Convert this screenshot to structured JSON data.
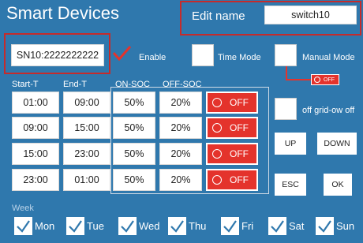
{
  "title": "Smart Devices",
  "edit_name": {
    "label": "Edit name",
    "value": "switch10"
  },
  "serial": "SN10:2222222222",
  "enable_label": "Enable",
  "time_mode_label": "Time Mode",
  "manual_mode_label": "Manual Mode",
  "manual_off_label": "OFF",
  "headers": {
    "start": "Start-T",
    "end": "End-T",
    "on_soc": "ON-SOC",
    "off_soc": "OFF-SOC"
  },
  "rows": [
    {
      "start": "01:00",
      "end": "09:00",
      "on_soc": "50%",
      "off_soc": "20%",
      "state": "OFF"
    },
    {
      "start": "09:00",
      "end": "15:00",
      "on_soc": "50%",
      "off_soc": "20%",
      "state": "OFF"
    },
    {
      "start": "15:00",
      "end": "23:00",
      "on_soc": "50%",
      "off_soc": "20%",
      "state": "OFF"
    },
    {
      "start": "23:00",
      "end": "01:00",
      "on_soc": "50%",
      "off_soc": "20%",
      "state": "OFF"
    }
  ],
  "offgrid_label": "off grid-ow off",
  "buttons": {
    "up": "UP",
    "down": "DOWN",
    "esc": "ESC",
    "ok": "OK"
  },
  "week_label": "Week",
  "days": [
    "Mon",
    "Tue",
    "Wed",
    "Thu",
    "Fri",
    "Sat",
    "Sun"
  ],
  "colors": {
    "background": "#2f78ad",
    "accent_red": "#e4332c",
    "frame_red": "#c52b2b"
  }
}
